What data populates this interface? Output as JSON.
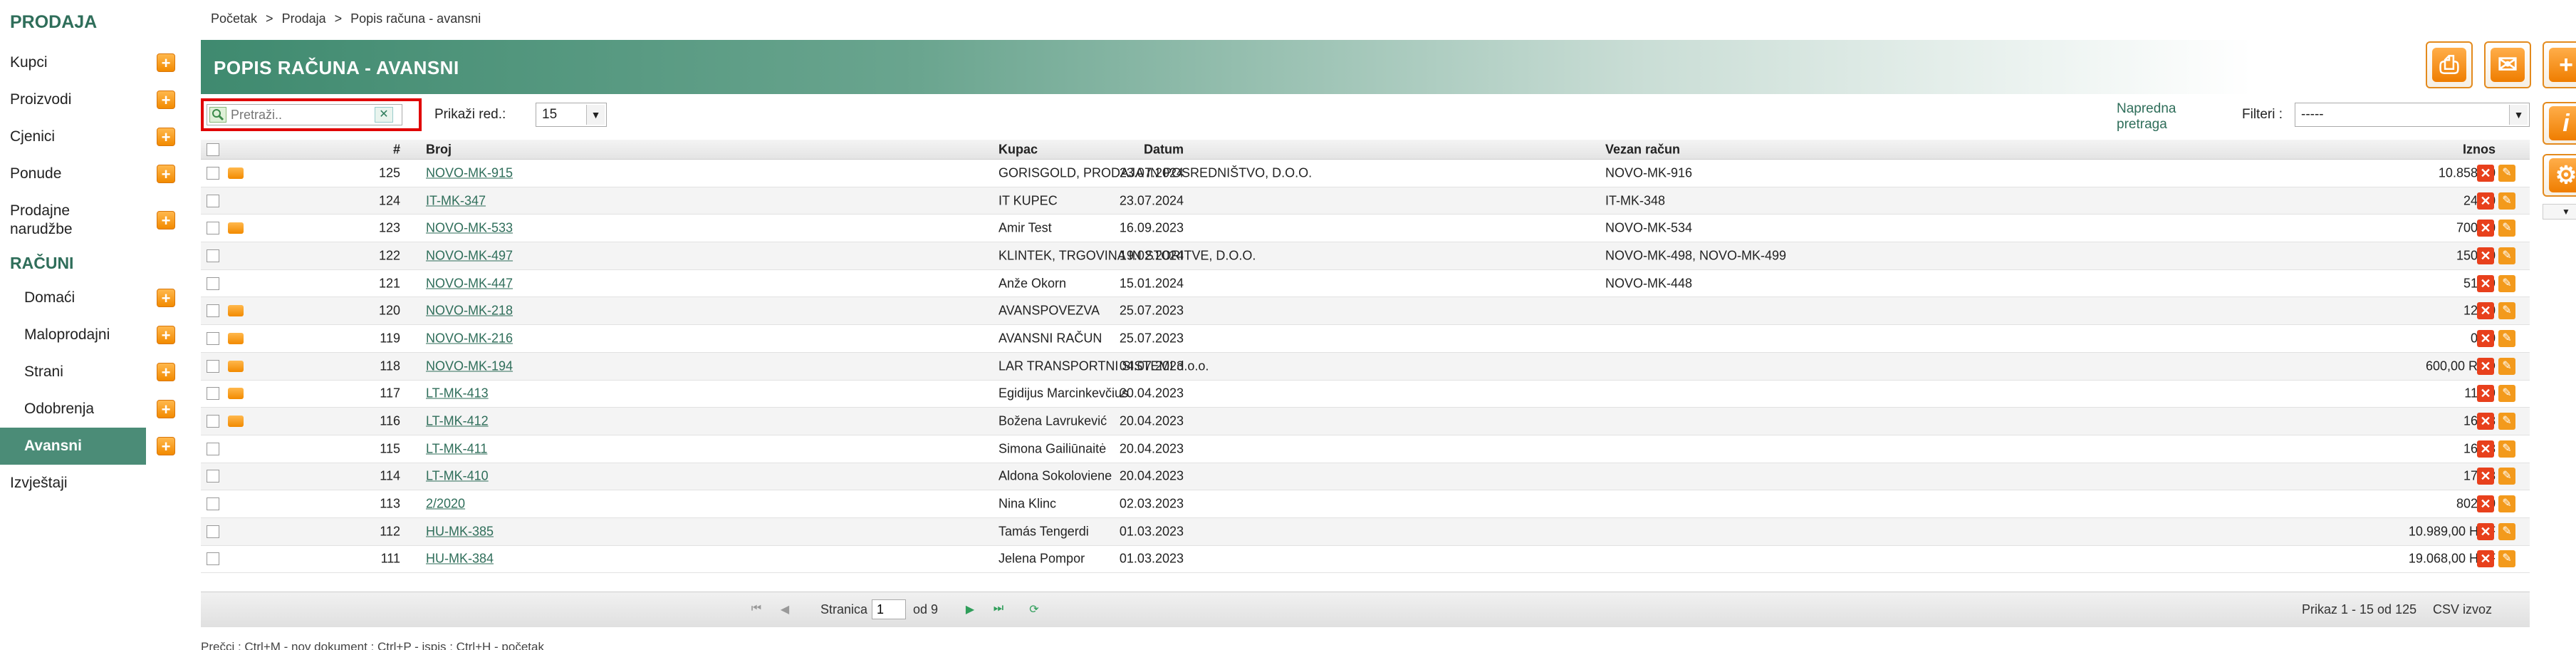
{
  "sidebar": {
    "section_prodaja": "PRODAJA",
    "items": [
      {
        "label": "Kupci"
      },
      {
        "label": "Proizvodi"
      },
      {
        "label": "Cjenici"
      },
      {
        "label": "Ponude"
      },
      {
        "label": "Prodajne narudžbe"
      }
    ],
    "section_racuni": "RAČUNI",
    "racuni_items": [
      {
        "label": "Domaći"
      },
      {
        "label": "Maloprodajni"
      },
      {
        "label": "Strani"
      },
      {
        "label": "Odobrenja"
      },
      {
        "label": "Avansni"
      }
    ],
    "izvjestaji": "Izvještaji",
    "plus_icon": "+"
  },
  "breadcrumb": {
    "items": [
      "Početak",
      "Prodaja",
      "Popis računa - avansni"
    ],
    "separator": ">"
  },
  "page_title": "POPIS RAČUNA - AVANSNI",
  "toolbar": {
    "search_placeholder": "Pretraži..",
    "clear_symbol": "✕",
    "rows_label": "Prikaži red.:",
    "rows_value": "15",
    "advanced_search": "Napredna pretraga",
    "filter_label": "Filteri :",
    "filter_value": "-----",
    "dropdown_arrow": "▼"
  },
  "table": {
    "headers": {
      "num": "#",
      "broj": "Broj",
      "datum": "Datum",
      "kupac": "Kupac",
      "vezan": "Vezan račun",
      "iznos": "Iznos"
    },
    "rows": [
      {
        "print": true,
        "num": "125",
        "broj": "NOVO-MK-915",
        "datum": "23.07.2024",
        "kupac": "GORISGOLD, PRODAJA IN POSREDNIŠTVO, D.O.O.",
        "vezan": "NOVO-MK-916",
        "iznos": "10.858,00"
      },
      {
        "print": false,
        "num": "124",
        "broj": "IT-MK-347",
        "datum": "23.07.2024",
        "kupac": "IT KUPEC",
        "vezan": "IT-MK-348",
        "iznos": "24,40"
      },
      {
        "print": true,
        "num": "123",
        "broj": "NOVO-MK-533",
        "datum": "16.09.2023",
        "kupac": "Amir Test",
        "vezan": "NOVO-MK-534",
        "iznos": "700,00"
      },
      {
        "print": false,
        "num": "122",
        "broj": "NOVO-MK-497",
        "datum": "19.02.2024",
        "kupac": "KLINTEK, TRGOVINA IN STORITVE, D.O.O.",
        "vezan": "NOVO-MK-498, NOVO-MK-499",
        "iznos": "150,00"
      },
      {
        "print": false,
        "num": "121",
        "broj": "NOVO-MK-447",
        "datum": "15.01.2024",
        "kupac": "Anže Okorn",
        "vezan": "NOVO-MK-448",
        "iznos": "51,99"
      },
      {
        "print": true,
        "num": "120",
        "broj": "NOVO-MK-218",
        "datum": "25.07.2023",
        "kupac": "AVANSPOVEZVA",
        "vezan": "",
        "iznos": "12,20"
      },
      {
        "print": true,
        "num": "119",
        "broj": "NOVO-MK-216",
        "datum": "25.07.2023",
        "kupac": "AVANSNI RAČUN",
        "vezan": "",
        "iznos": "0,00"
      },
      {
        "print": true,
        "num": "118",
        "broj": "NOVO-MK-194",
        "datum": "04.07.2023",
        "kupac": "LAR TRANSPORTNI SISTEMI d.o.o.",
        "vezan": "",
        "iznos": "600,00 RSD"
      },
      {
        "print": true,
        "num": "117",
        "broj": "LT-MK-413",
        "datum": "20.04.2023",
        "kupac": "Egidijus Marcinkevčius",
        "vezan": "",
        "iznos": "11,99"
      },
      {
        "print": true,
        "num": "116",
        "broj": "LT-MK-412",
        "datum": "20.04.2023",
        "kupac": "Božena Lavrukević",
        "vezan": "",
        "iznos": "16,98"
      },
      {
        "print": false,
        "num": "115",
        "broj": "LT-MK-411",
        "datum": "20.04.2023",
        "kupac": "Simona Gailiūnaitė",
        "vezan": "",
        "iznos": "16,98"
      },
      {
        "print": false,
        "num": "114",
        "broj": "LT-MK-410",
        "datum": "20.04.2023",
        "kupac": "Aldona Sokoloviene",
        "vezan": "",
        "iznos": "17,98"
      },
      {
        "print": false,
        "num": "113",
        "broj": "2/2020",
        "datum": "02.03.2023",
        "kupac": "Nina Klinc",
        "vezan": "",
        "iznos": "802,00"
      },
      {
        "print": false,
        "num": "112",
        "broj": "HU-MK-385",
        "datum": "01.03.2023",
        "kupac": "Tamás Tengerdi",
        "vezan": "",
        "iznos": "10.989,00 HUF"
      },
      {
        "print": false,
        "num": "111",
        "broj": "HU-MK-384",
        "datum": "01.03.2023",
        "kupac": "Jelena Pompor",
        "vezan": "",
        "iznos": "19.068,00 HUF"
      }
    ],
    "delete_symbol": "✕",
    "edit_symbol": "✎"
  },
  "pager": {
    "page_label": "Stranica",
    "page_value": "1",
    "of_label": "od 9",
    "summary": "Prikaz 1 - 15 od 125",
    "csv": "CSV izvoz"
  },
  "shortcuts": "Prečci : Ctrl+M - nov dokument ; Ctrl+P - ispis ; Ctrl+H - početak",
  "icons": {
    "print": "print-icon",
    "email": "email-icon",
    "add": "plus-icon",
    "info": "info-icon",
    "settings": "gear-icon"
  },
  "colors": {
    "accent": "#4b8c77",
    "orange": "#f28a00",
    "highlight": "#e00000"
  }
}
